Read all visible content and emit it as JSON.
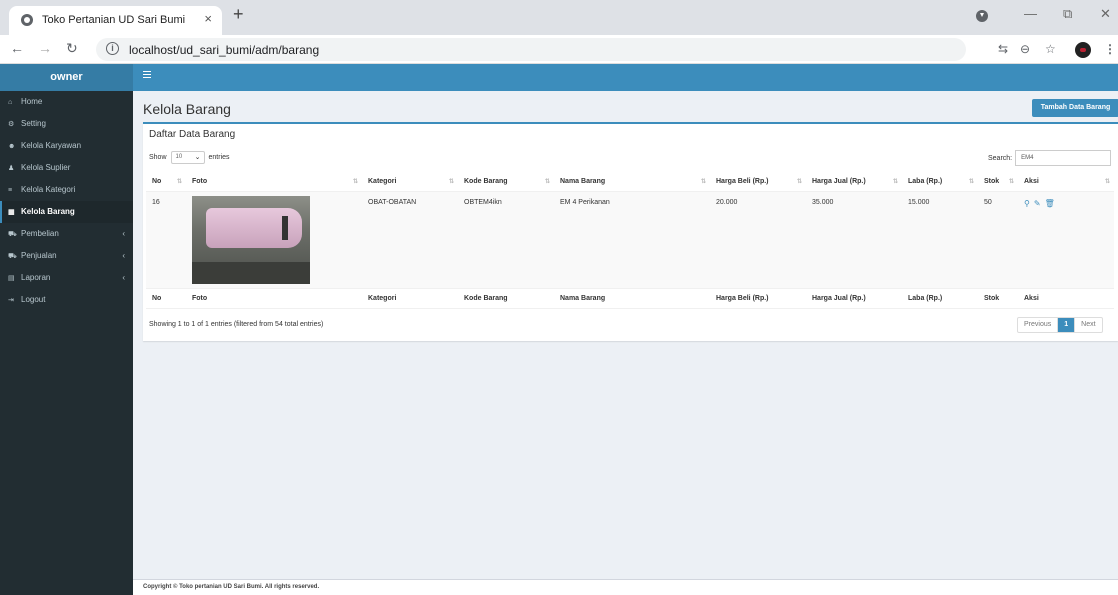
{
  "browser": {
    "tab_title": "Toko Pertanian UD Sari Bumi",
    "tab_close": "×",
    "new_tab": "+",
    "url": "localhost/ud_sari_bumi/adm/barang"
  },
  "sidebar": {
    "brand": "owner",
    "items": [
      {
        "label": "Home",
        "icon": "home-icon"
      },
      {
        "label": "Setting",
        "icon": "gear-icon"
      },
      {
        "label": "Kelola Karyawan",
        "icon": "users-icon"
      },
      {
        "label": "Kelola Suplier",
        "icon": "user-icon"
      },
      {
        "label": "Kelola Kategori",
        "icon": "list-icon"
      },
      {
        "label": "Kelola Barang",
        "icon": "table-icon",
        "active": true
      },
      {
        "label": "Pembelian",
        "icon": "cart-icon",
        "expandable": true
      },
      {
        "label": "Penjualan",
        "icon": "cart-icon",
        "expandable": true
      },
      {
        "label": "Laporan",
        "icon": "report-icon",
        "expandable": true
      },
      {
        "label": "Logout",
        "icon": "logout-icon"
      }
    ]
  },
  "page": {
    "title": "Kelola Barang",
    "add_button": "Tambah Data Barang",
    "box_title": "Daftar Data Barang",
    "show_label": "Show",
    "page_length": "10",
    "entries_label": "entries",
    "search_label": "Search:",
    "search_value": "EM4"
  },
  "table": {
    "columns": [
      "No",
      "Foto",
      "Kategori",
      "Kode Barang",
      "Nama Barang",
      "Harga Beli (Rp.)",
      "Harga Jual (Rp.)",
      "Laba (Rp.)",
      "Stok",
      "Aksi"
    ],
    "rows": [
      {
        "no": "16",
        "kategori": "OBAT-OBATAN",
        "kode": "OBTEM4ikn",
        "nama": "EM 4 Perikanan",
        "harga_beli": "20.000",
        "harga_jual": "35.000",
        "laba": "15.000",
        "stok": "50"
      }
    ]
  },
  "pagination": {
    "info": "Showing 1 to 1 of 1 entries (filtered from 54 total entries)",
    "previous": "Previous",
    "current": "1",
    "next": "Next"
  },
  "footer": {
    "text": "Copyright © Toko pertanian UD Sari Bumi. All rights reserved."
  },
  "colors": {
    "primary": "#3c8dbc",
    "sidebar_bg": "#222d32",
    "brand_bg": "#357ca5",
    "content_bg": "#ecf0f5"
  }
}
